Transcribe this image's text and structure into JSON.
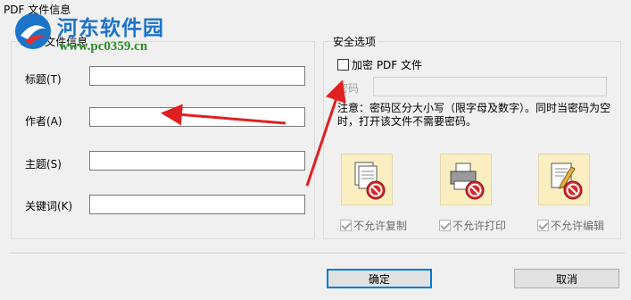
{
  "window": {
    "title": "PDF 文件信息"
  },
  "watermark": {
    "site_name": "河东软件园",
    "url": "www.pc0359.cn"
  },
  "file_info": {
    "legend": "PDF 文件信息",
    "fields": {
      "title": {
        "label": "标题(T)",
        "value": ""
      },
      "author": {
        "label": "作者(A)",
        "value": ""
      },
      "subject": {
        "label": "主题(S)",
        "value": ""
      },
      "keywords": {
        "label": "关键词(K)",
        "value": ""
      }
    }
  },
  "security": {
    "legend": "安全选项",
    "encrypt": {
      "label": "加密 PDF 文件",
      "checked": false
    },
    "password": {
      "label": "密码",
      "value": "",
      "enabled": false
    },
    "note": "注意：密码区分大小写（限字母及数字）。同时当密码为空时，打开该文件不需要密码。",
    "permissions": [
      {
        "label": "不允许复制",
        "icon": "copy-document-icon",
        "checked": true,
        "enabled": false
      },
      {
        "label": "不允许打印",
        "icon": "printer-icon",
        "checked": true,
        "enabled": false
      },
      {
        "label": "不允许编辑",
        "icon": "edit-document-icon",
        "checked": true,
        "enabled": false
      }
    ]
  },
  "buttons": {
    "ok": "确定",
    "cancel": "取消"
  },
  "colors": {
    "dialog_background": "#f0f0f0",
    "arrow": "#e02020",
    "watermark_blue": "#1c74c8",
    "watermark_green": "#2a8a2a",
    "permission_icon_background": "#fbeec1",
    "deny_badge": "#d42a2a"
  }
}
